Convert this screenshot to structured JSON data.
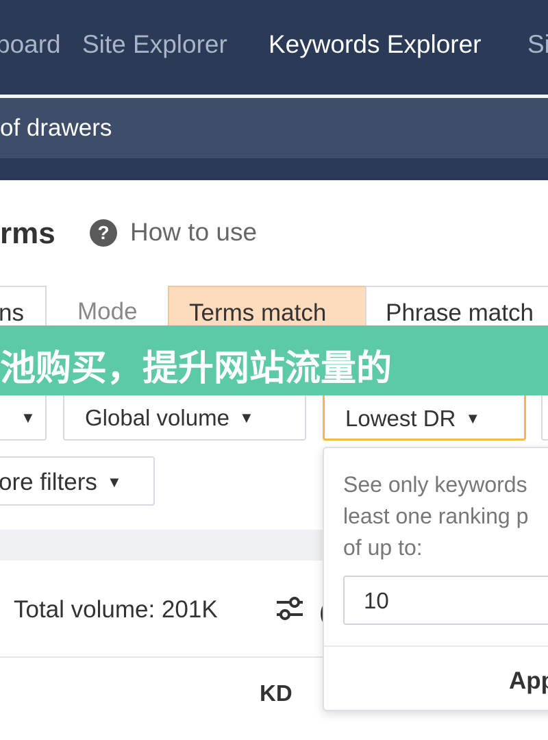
{
  "nav": {
    "items": [
      "board",
      "Site Explorer",
      "Keywords Explorer",
      "Si"
    ],
    "active_index": 2
  },
  "search": {
    "value": "of drawers"
  },
  "report": {
    "title": "rms",
    "help_icon": "question-circle-icon",
    "help_label": "How to use"
  },
  "mode_bar": {
    "left_tab": "ns",
    "mode_label": "Mode",
    "options": [
      "Terms match",
      "Phrase match"
    ],
    "active": "Terms match"
  },
  "banner": {
    "text": "池购买，提升网站流量的"
  },
  "filters": {
    "dropdowns": [
      "",
      "Global volume",
      "Lowest DR"
    ],
    "highlighted": "Lowest DR",
    "more_filters": "ore filters",
    "caret_icon": "caret-down-icon"
  },
  "popover": {
    "lines": [
      "See only keywords",
      "least one ranking p",
      "of up to:"
    ],
    "input_value": "10",
    "apply_label": "App"
  },
  "results": {
    "total_volume": "Total volume: 201K",
    "sliders_icon": "sliders-icon",
    "more_icon": "more-icon",
    "columns": [
      "KD"
    ]
  },
  "colors": {
    "nav_bg": "#2a3a57",
    "search_bg": "#3e4d69",
    "active_option_bg": "#fcdcbc",
    "highlight_border": "#f5b74a",
    "banner_bg": "#5cc9a7"
  }
}
